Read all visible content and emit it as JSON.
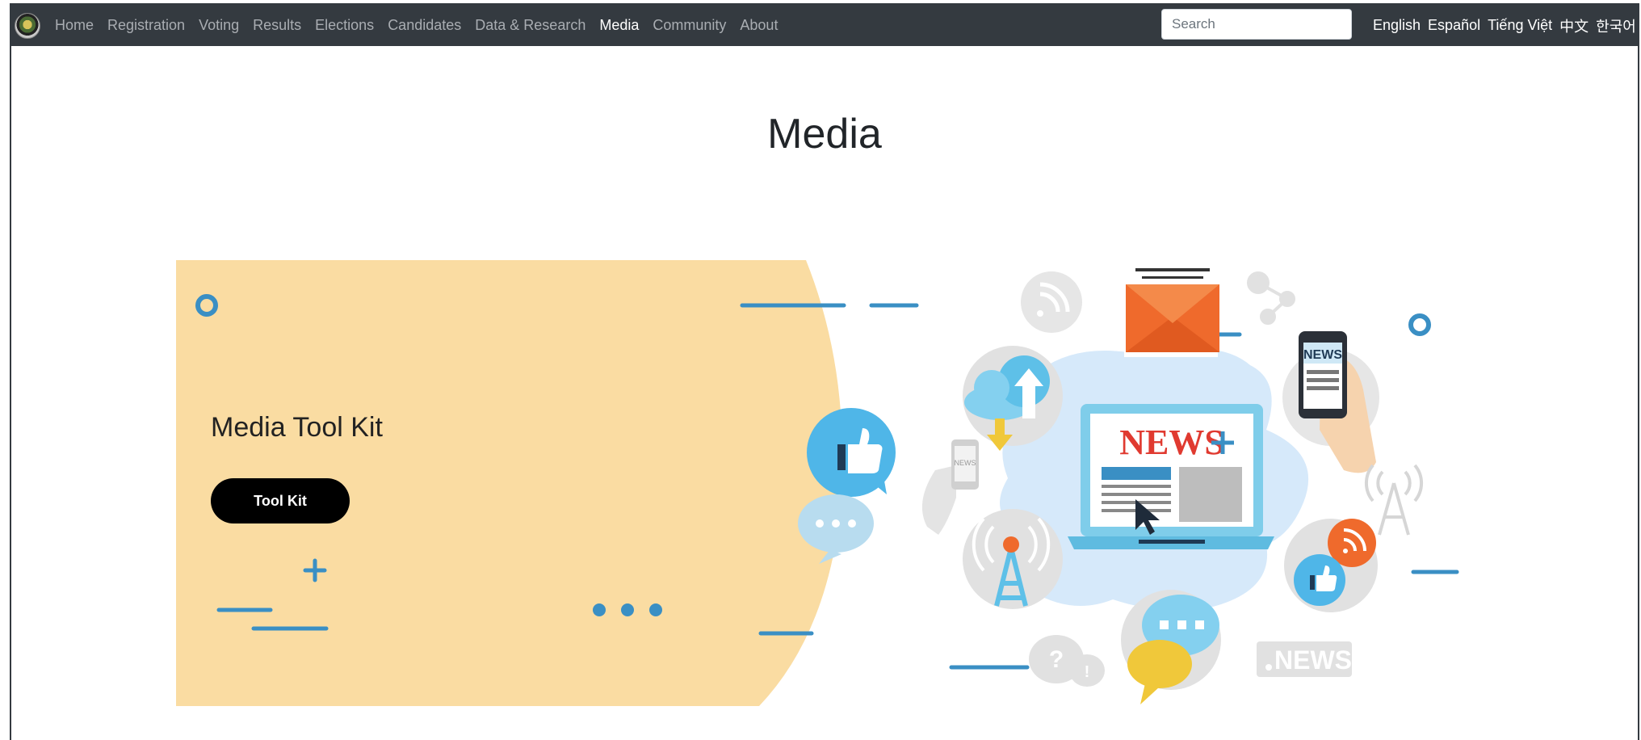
{
  "nav": {
    "links": [
      {
        "label": "Home",
        "active": false
      },
      {
        "label": "Registration",
        "active": false
      },
      {
        "label": "Voting",
        "active": false
      },
      {
        "label": "Results",
        "active": false
      },
      {
        "label": "Elections",
        "active": false
      },
      {
        "label": "Candidates",
        "active": false
      },
      {
        "label": "Data & Research",
        "active": false
      },
      {
        "label": "Media",
        "active": true
      },
      {
        "label": "Community",
        "active": false
      },
      {
        "label": "About",
        "active": false
      }
    ],
    "search_placeholder": "Search",
    "languages": [
      "English",
      "Español",
      "Tiếng Việt",
      "中文",
      "한국어"
    ]
  },
  "page": {
    "title": "Media"
  },
  "hero": {
    "card_title": "Media Tool Kit",
    "button_label": "Tool Kit",
    "illustration_text": {
      "laptop_headline": "NEWS",
      "phone_label": "NEWS",
      "small_phone_label": "NEWS",
      "badge_label": "NEWS"
    }
  },
  "colors": {
    "navbar_bg": "#343a40",
    "nav_link": "#a9adb2",
    "nav_active": "#ffffff",
    "card_bg": "#fadca2",
    "accent_blue": "#3a8fc4",
    "button_bg": "#000000"
  }
}
